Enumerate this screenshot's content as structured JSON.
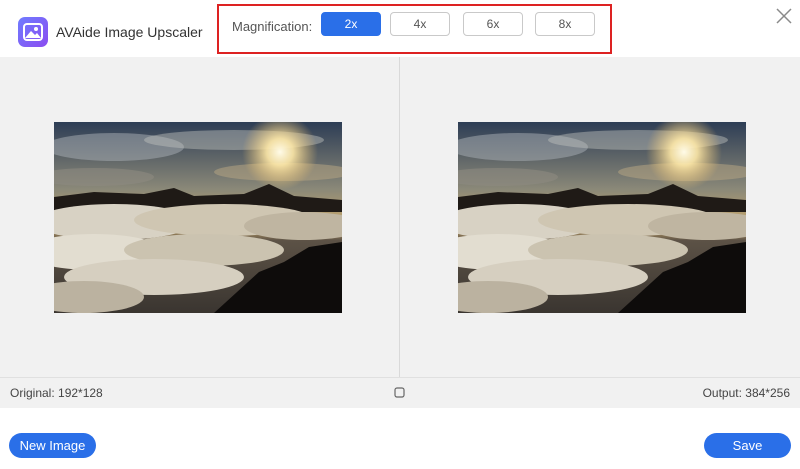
{
  "app": {
    "title": "AVAide Image Upscaler"
  },
  "magnification": {
    "label": "Magnification:",
    "options": [
      "2x",
      "4x",
      "6x",
      "8x"
    ],
    "selected": "2x"
  },
  "info": {
    "original": "Original: 192*128",
    "output": "Output: 384*256"
  },
  "buttons": {
    "new_image": "New Image",
    "save": "Save"
  },
  "icons": {
    "logo": "image-icon",
    "close": "close-icon",
    "compare": "compare-icon"
  },
  "colors": {
    "accent": "#2a6fe8",
    "highlight_border": "#dd2222"
  }
}
